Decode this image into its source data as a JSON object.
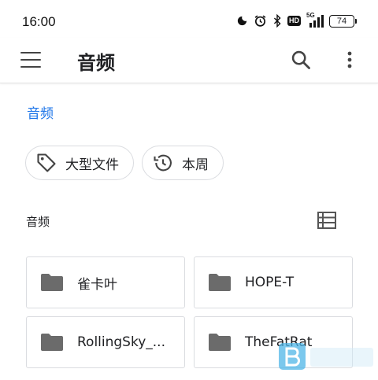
{
  "status_bar": {
    "time": "16:00",
    "network": "5G",
    "hd_label": "HD",
    "battery_level": "74",
    "icons": [
      "moon-icon",
      "alarm-icon",
      "bluetooth-icon",
      "hd-icon",
      "signal-icon",
      "battery-icon"
    ]
  },
  "app_bar": {
    "title": "音频",
    "icons": [
      "menu-icon",
      "search-icon",
      "more-vert-icon"
    ]
  },
  "breadcrumb": "音频",
  "filter_chips": [
    {
      "label": "大型文件",
      "icon": "tag-icon"
    },
    {
      "label": "本周",
      "icon": "history-icon"
    }
  ],
  "section": {
    "title": "音频",
    "view_icon": "list-view-icon"
  },
  "folders": [
    {
      "name": "雀卡叶",
      "icon": "folder-icon"
    },
    {
      "name": "HOPE-T",
      "icon": "folder-icon"
    },
    {
      "name": "RollingSky_...",
      "icon": "folder-icon"
    },
    {
      "name": "TheFatRat",
      "icon": "folder-icon"
    }
  ],
  "colors": {
    "accent": "#1a73e8",
    "folder_icon": "#6b6b6b",
    "border": "#dadce0"
  }
}
